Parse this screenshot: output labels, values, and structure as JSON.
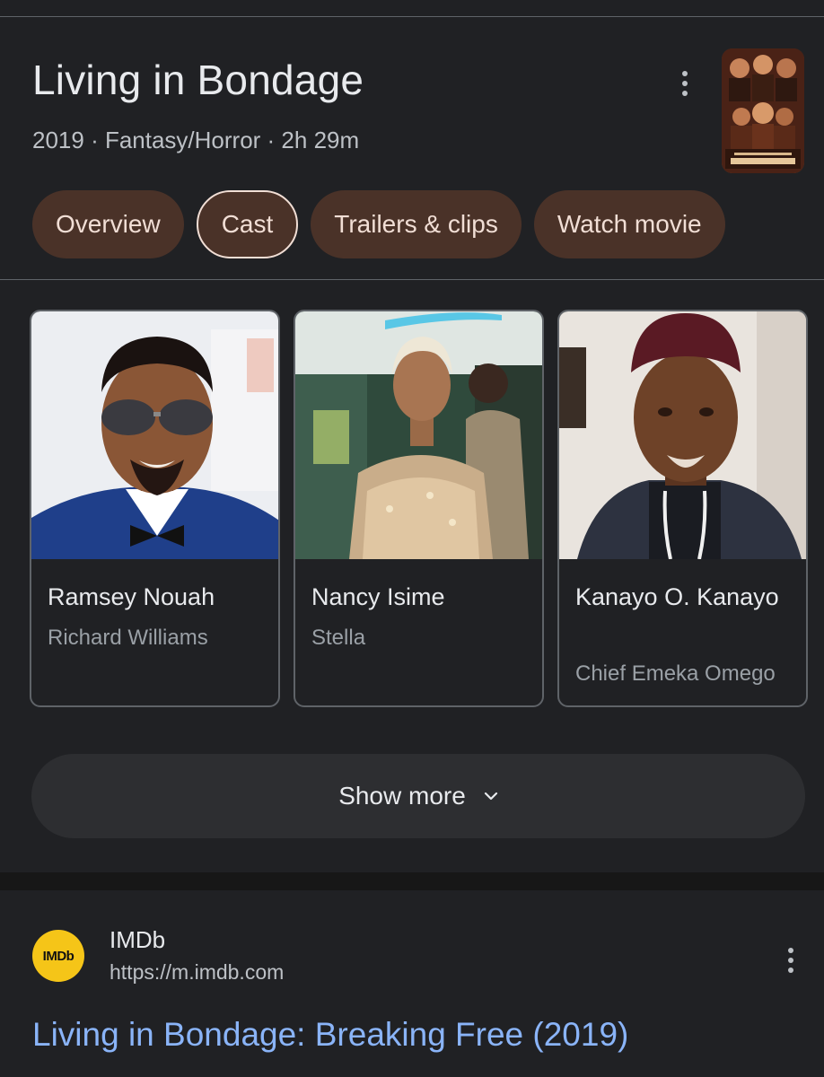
{
  "header": {
    "title": "Living in Bondage",
    "meta": "2019 · Fantasy/Horror · 2h 29m",
    "more_icon": "more-vert-icon",
    "poster_alt": "Living in Bondage poster"
  },
  "tabs": [
    {
      "label": "Overview",
      "active": false
    },
    {
      "label": "Cast",
      "active": true
    },
    {
      "label": "Trailers & clips",
      "active": false
    },
    {
      "label": "Watch movie",
      "active": false
    }
  ],
  "cast": [
    {
      "name": "Ramsey Nouah",
      "role": "Richard Williams"
    },
    {
      "name": "Nancy Isime",
      "role": "Stella"
    },
    {
      "name": "Kanayo O. Kanayo",
      "role": "Chief Emeka Omego"
    }
  ],
  "show_more": {
    "label": "Show more",
    "icon": "chevron-down-icon"
  },
  "result": {
    "favicon_text": "IMDb",
    "site_name": "IMDb",
    "url": "https://m.imdb.com",
    "title": "Living in Bondage: Breaking Free (2019)",
    "more_icon": "more-vert-icon"
  },
  "colors": {
    "background": "#202124",
    "chip": "#4a3228",
    "chip_text": "#f1ded5",
    "link": "#8ab4f8",
    "imdb_yellow": "#f5c518"
  }
}
